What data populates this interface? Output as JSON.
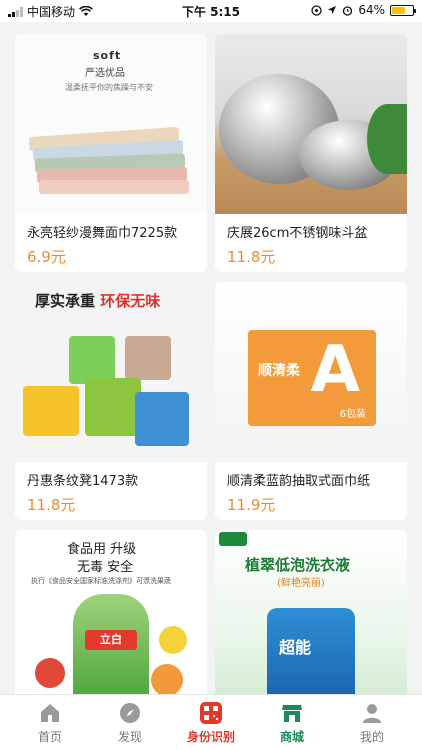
{
  "status_bar": {
    "carrier": "中国移动",
    "time": "下午 5:15",
    "battery_percent": "64%",
    "icons": [
      "signal-icon",
      "wifi-icon",
      "location-icon",
      "alarm-icon",
      "battery-icon"
    ]
  },
  "products": [
    {
      "title": "永亮轻纱漫舞面巾7225款",
      "price": "6.9元",
      "image_text": [
        "soft",
        "严选优品",
        "温柔抚平你的焦躁与不安"
      ]
    },
    {
      "title": "庆展26cm不锈钢味斗盆",
      "price": "11.8元"
    },
    {
      "title": "丹惠条纹凳1473款",
      "price": "11.8元",
      "image_text": [
        "厚实承重",
        "环保无味"
      ]
    },
    {
      "title": "顺清柔蓝韵抽取式面巾纸",
      "price": "11.9元",
      "image_text": [
        "顺清柔",
        "A",
        "6包装"
      ]
    },
    {
      "title": "",
      "price": "",
      "image_text": [
        "食品用 升级",
        "无毒 安全",
        "执行《食品安全国家标准洗涤剂》可漂洗果蔬",
        "立白"
      ]
    },
    {
      "title": "",
      "price": "",
      "image_text": [
        "植翠低泡洗衣液",
        "(鲜艳亮丽)",
        "超能"
      ]
    }
  ],
  "tabbar": {
    "items": [
      {
        "label": "首页",
        "icon": "home-icon"
      },
      {
        "label": "发现",
        "icon": "compass-icon"
      },
      {
        "label": "身份识别",
        "icon": "qrcode-icon"
      },
      {
        "label": "商城",
        "icon": "shop-icon"
      },
      {
        "label": "我的",
        "icon": "user-icon"
      }
    ],
    "active": "商城"
  },
  "colors": {
    "price": "#f08a2c",
    "active_tab": "#1a8a59",
    "identify_tab": "#e2392b"
  }
}
